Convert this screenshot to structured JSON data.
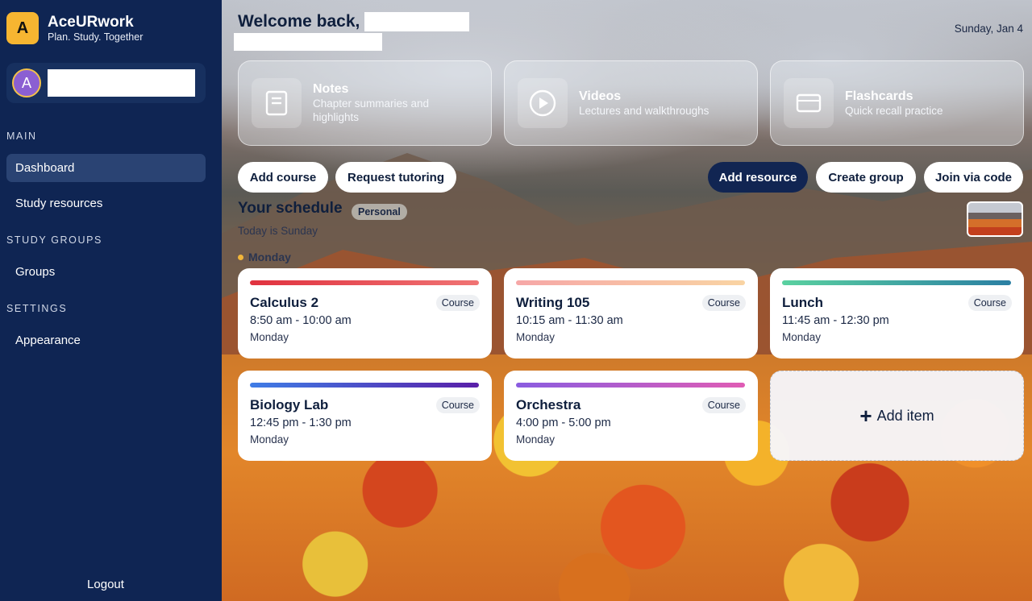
{
  "brand": {
    "logo_letter": "A",
    "name": "AceURwork",
    "tagline": "Plan. Study. Together"
  },
  "user": {
    "avatar_letter": "A"
  },
  "sidebar": {
    "sections": [
      {
        "label": "MAIN",
        "items": [
          {
            "label": "Dashboard",
            "active": true
          },
          {
            "label": "Study resources",
            "active": false
          }
        ]
      },
      {
        "label": "STUDY GROUPS",
        "items": [
          {
            "label": "Groups",
            "active": false
          }
        ]
      },
      {
        "label": "SETTINGS",
        "items": [
          {
            "label": "Appearance",
            "active": false
          }
        ]
      }
    ],
    "logout_label": "Logout"
  },
  "header": {
    "welcome": "Welcome back,",
    "date": "Sunday, Jan 4"
  },
  "resources": [
    {
      "title": "Notes",
      "description": "Chapter summaries and highlights",
      "icon": "notes-icon"
    },
    {
      "title": "Videos",
      "description": "Lectures and walkthroughs",
      "icon": "play-icon"
    },
    {
      "title": "Flashcards",
      "description": "Quick recall practice",
      "icon": "flashcard-icon"
    }
  ],
  "actions": {
    "add_course": "Add course",
    "request_tutoring": "Request tutoring",
    "add_resource": "Add resource",
    "create_group": "Create group",
    "join_via_code": "Join via code"
  },
  "schedule": {
    "title": "Your schedule",
    "badge": "Personal",
    "subtitle": "Today is Sunday",
    "day_label": "Monday",
    "events": [
      {
        "title": "Calculus 2",
        "tag": "Course",
        "time": "8:50 am - 10:00 am",
        "day": "Monday",
        "color_from": "#e0323f",
        "color_to": "#f07474"
      },
      {
        "title": "Writing 105",
        "tag": "Course",
        "time": "10:15 am - 11:30 am",
        "day": "Monday",
        "color_from": "#f6a7a7",
        "color_to": "#f9d4a3"
      },
      {
        "title": "Lunch",
        "tag": "Course",
        "time": "11:45 am - 12:30 pm",
        "day": "Monday",
        "color_from": "#5ad1a0",
        "color_to": "#2b7fa3"
      },
      {
        "title": "Biology Lab",
        "tag": "Course",
        "time": "12:45 pm - 1:30 pm",
        "day": "Monday",
        "color_from": "#3f7de6",
        "color_to": "#5a1fa8"
      },
      {
        "title": "Orchestra",
        "tag": "Course",
        "time": "4:00 pm - 5:00 pm",
        "day": "Monday",
        "color_from": "#8a5ce0",
        "color_to": "#e05cb4"
      }
    ],
    "add_item_label": "Add item"
  }
}
